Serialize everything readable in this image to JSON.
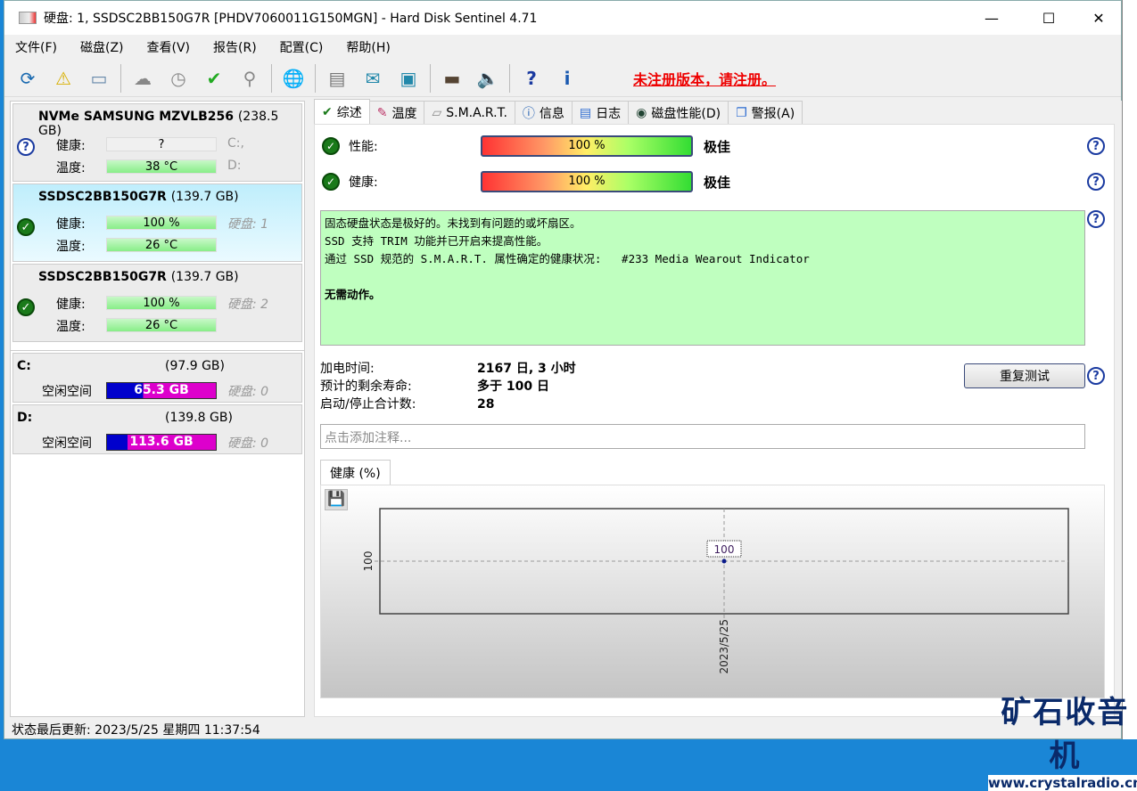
{
  "window": {
    "title": "硬盘:  1, SSDSC2BB150G7R [PHDV7060011G150MGN]  -  Hard Disk Sentinel 4.71",
    "minimize": "—",
    "maximize": "☐",
    "close": "✕"
  },
  "menu": [
    "文件(F)",
    "磁盘(Z)",
    "查看(V)",
    "报告(R)",
    "配置(C)",
    "帮助(H)"
  ],
  "toolbar": {
    "icons": [
      "refresh-icon",
      "refresh-alert-icon",
      "disk-icon",
      "disk-grey-icon",
      "disk-clock-icon",
      "disk-check-icon",
      "disk-search-icon",
      "globe-disk-icon",
      "document-icon",
      "email-icon",
      "network-icon",
      "terminal-icon",
      "speaker-icon",
      "help-icon",
      "info-icon"
    ],
    "unregistered": "未注册版本，请注册。"
  },
  "disks": [
    {
      "name": "NVMe   SAMSUNG MZVLB256",
      "size": "(238.5 GB)",
      "status": "unknown",
      "health_label": "健康:",
      "health": "?",
      "temp_label": "温度:",
      "temp": "38 °C",
      "side1": "C:,",
      "side2": "D:"
    },
    {
      "name": "SSDSC2BB150G7R",
      "size": "(139.7 GB)",
      "status": "ok",
      "health_label": "健康:",
      "health": "100 %",
      "temp_label": "温度:",
      "temp": "26 °C",
      "side1": "硬盘:  1",
      "side2": ""
    },
    {
      "name": "SSDSC2BB150G7R",
      "size": "(139.7 GB)",
      "status": "ok",
      "health_label": "健康:",
      "health": "100 %",
      "temp_label": "温度:",
      "temp": "26 °C",
      "side1": "硬盘:  2",
      "side2": ""
    }
  ],
  "volumes": [
    {
      "name": "C:",
      "size": "(97.9 GB)",
      "free_label": "空闲空间",
      "free": "65.3 GB",
      "free_fraction": 0.667,
      "disk": "硬盘:  0"
    },
    {
      "name": "D:",
      "size": "(139.8 GB)",
      "free_label": "空闲空间",
      "free": "113.6 GB",
      "free_fraction": 0.813,
      "disk": "硬盘:  0"
    }
  ],
  "tabs": [
    "综述",
    "温度",
    "S.M.A.R.T.",
    "信息",
    "日志",
    "磁盘性能(D)",
    "警报(A)"
  ],
  "overview": {
    "perf_label": "性能:",
    "perf_value": "100 %",
    "perf_rating": "极佳",
    "health_label": "健康:",
    "health_value": "100 %",
    "health_rating": "极佳",
    "message": [
      "固态硬盘状态是极好的。未找到有问题的或坏扇区。",
      "SSD 支持 TRIM 功能并已开启来提高性能。",
      "通过 SSD 规范的 S.M.A.R.T. 属性确定的健康状况:   #233 Media Wearout Indicator"
    ],
    "action": "无需动作。",
    "power_on_label": "加电时间:",
    "power_on": "2167 日, 3 小时",
    "life_label": "预计的剩余寿命:",
    "life": "多于 100 日",
    "starts_label": "启动/停止合计数:",
    "starts": "28",
    "retest": "重复测试",
    "note_placeholder": "点击添加注释...",
    "chart_tab": "健康 (%)"
  },
  "chart_data": {
    "type": "line",
    "title": "健康 (%)",
    "x": [
      "2023/5/25"
    ],
    "values": [
      100
    ],
    "ytick": "100",
    "xtick": "2023/5/25",
    "point_label": "100",
    "grid": true
  },
  "status": "状态最后更新:   2023/5/25 星期四 11:37:54",
  "watermark": {
    "line1": "矿石收音机",
    "line2": "www.crystalradio.cn"
  },
  "colors": {
    "ok": "#1a7a1a",
    "message_bg": "#bfffbf",
    "unregistered": "#ee0000"
  }
}
